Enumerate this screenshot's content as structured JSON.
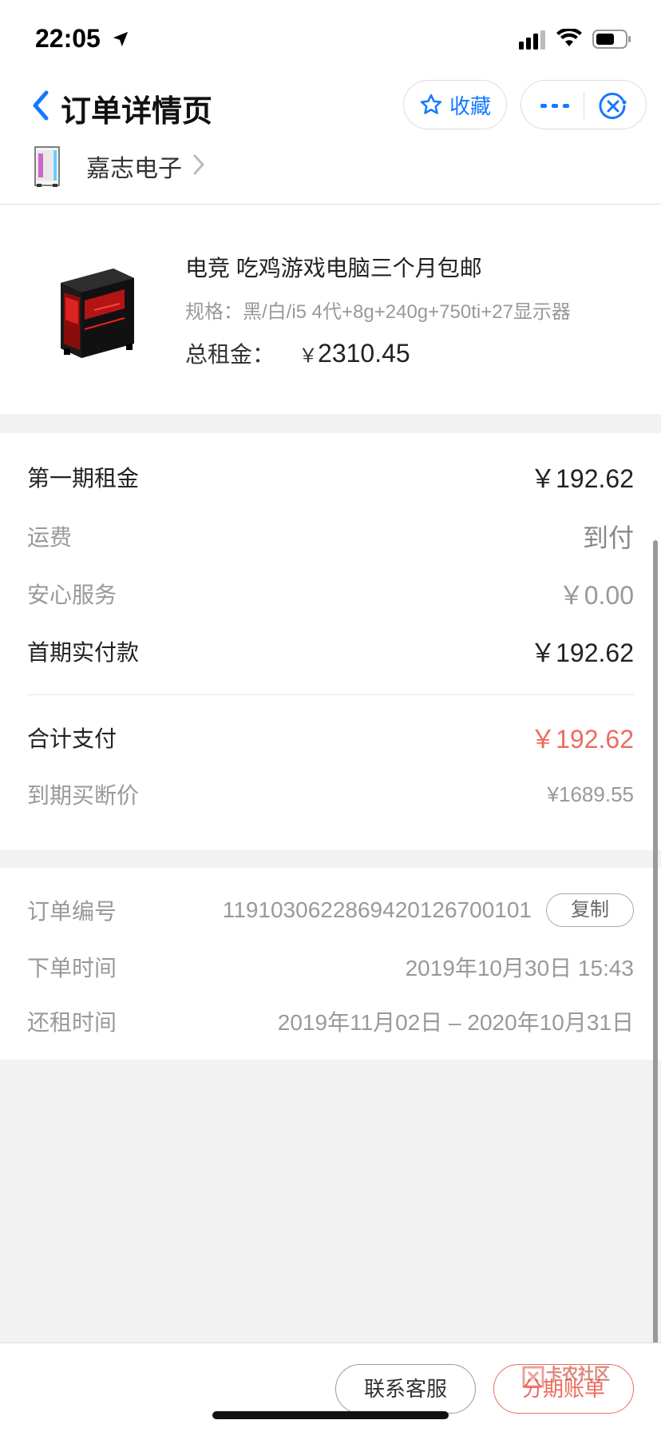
{
  "status_bar": {
    "time": "22:05"
  },
  "nav": {
    "title": "订单详情页",
    "favorite_label": "收藏",
    "shop_name": "嘉志电子"
  },
  "product": {
    "title": "电竞 吃鸡游戏电脑三个月包邮",
    "spec": "规格：黑/白/i5 4代+8g+240g+750ti+27显示器",
    "total_rent_label": "总租金：",
    "currency": "￥",
    "total_rent_value": "2310.45"
  },
  "costs": {
    "first_rent": {
      "label": "第一期租金",
      "value": "￥192.62"
    },
    "shipping": {
      "label": "运费",
      "value": "到付"
    },
    "service": {
      "label": "安心服务",
      "value": "￥0.00"
    },
    "first_payment": {
      "label": "首期实付款",
      "value": "￥192.62"
    },
    "total": {
      "label": "合计支付",
      "value": "￥192.62"
    },
    "buyout": {
      "label": "到期买断价",
      "value": "¥1689.55"
    }
  },
  "order": {
    "number": {
      "label": "订单编号",
      "value": "1191030622869420126700101",
      "copy_label": "复制"
    },
    "order_time": {
      "label": "下单时间",
      "value": "2019年10月30日 15:43"
    },
    "return_time": {
      "label": "还租时间",
      "value": "2019年11月02日 – 2020年10月31日"
    }
  },
  "bottom": {
    "contact_label": "联系客服",
    "bill_label": "分期账单",
    "watermark_text": "卡农社区"
  },
  "colors": {
    "accent_blue": "#1677ff",
    "highlight_red": "#ef6b5f"
  }
}
